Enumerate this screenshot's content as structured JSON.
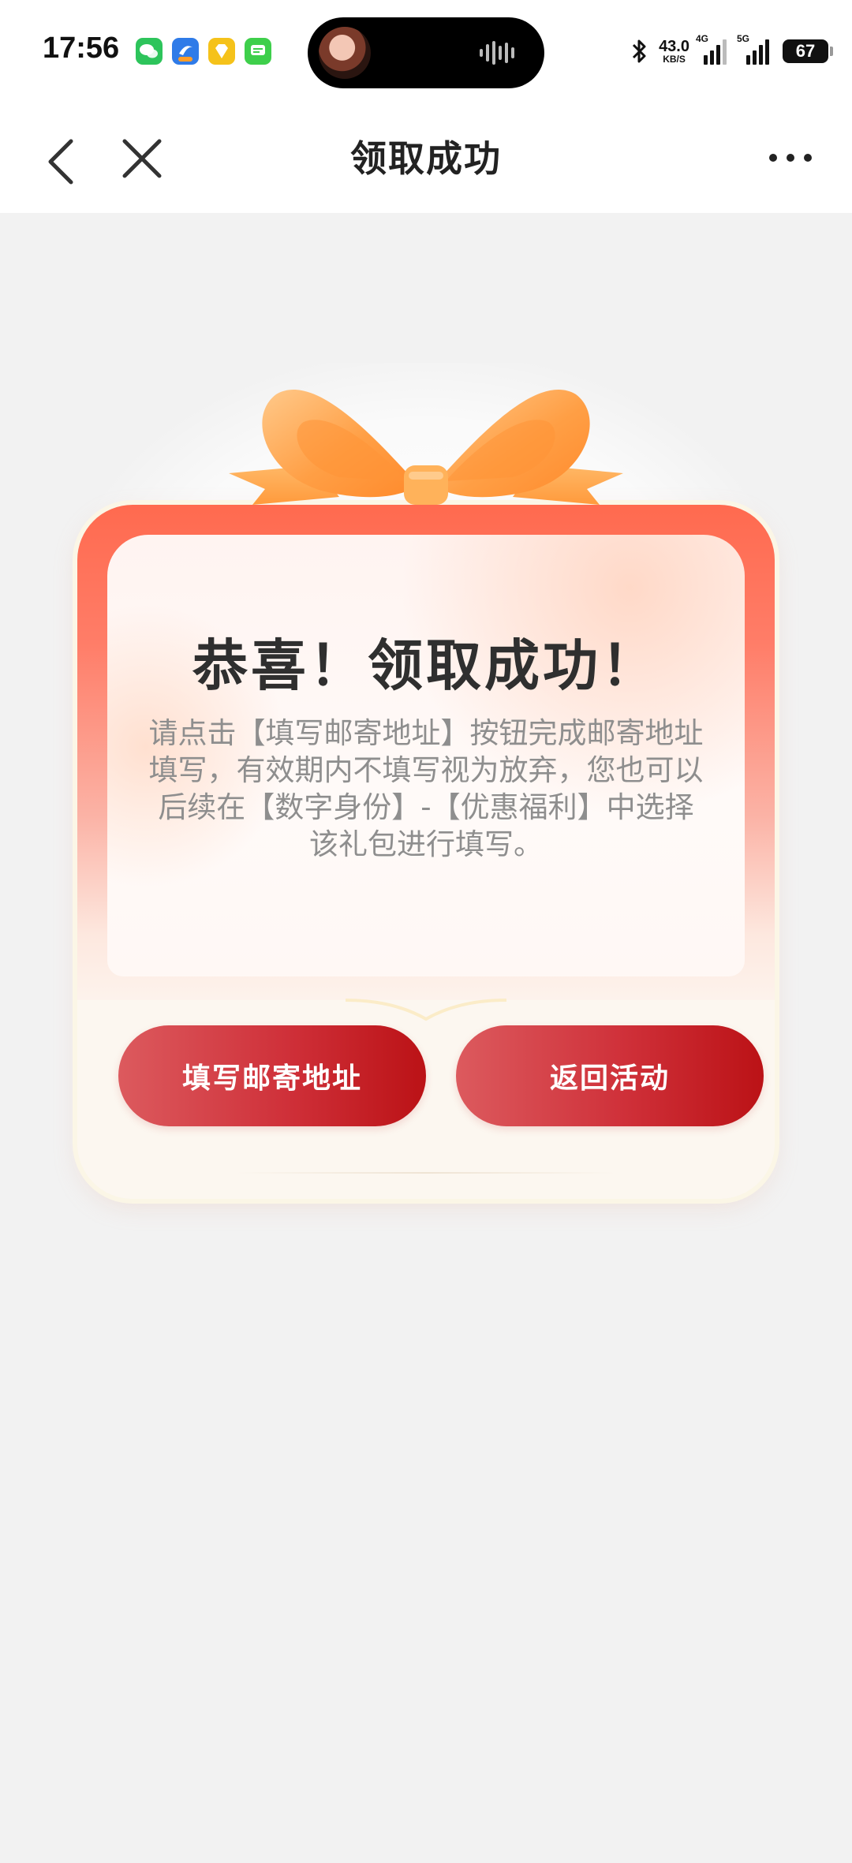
{
  "status_bar": {
    "time": "17:56",
    "net_speed_value": "43.0",
    "net_speed_unit": "KB/S",
    "signal_1_tag": "4G",
    "signal_2_tag": "5G",
    "battery": "67",
    "app_icons": [
      "wechat-icon",
      "browser-app-icon",
      "diamond-app-icon",
      "messages-icon"
    ]
  },
  "nav": {
    "title": "领取成功"
  },
  "card": {
    "title": "恭喜！领取成功！",
    "description": "请点击【填写邮寄地址】按钮完成邮寄地址填写，有效期内不填写视为放弃，您也可以后续在【数字身份】-【优惠福利】中选择该礼包进行填写。",
    "buttons": {
      "address_label": "填写邮寄地址",
      "return_label": "返回活动"
    }
  },
  "colors": {
    "accent_red": "#c8262d",
    "card_top": "#ff6a4f",
    "ribbon": "#ffa24a",
    "background": "#f2f2f2"
  }
}
